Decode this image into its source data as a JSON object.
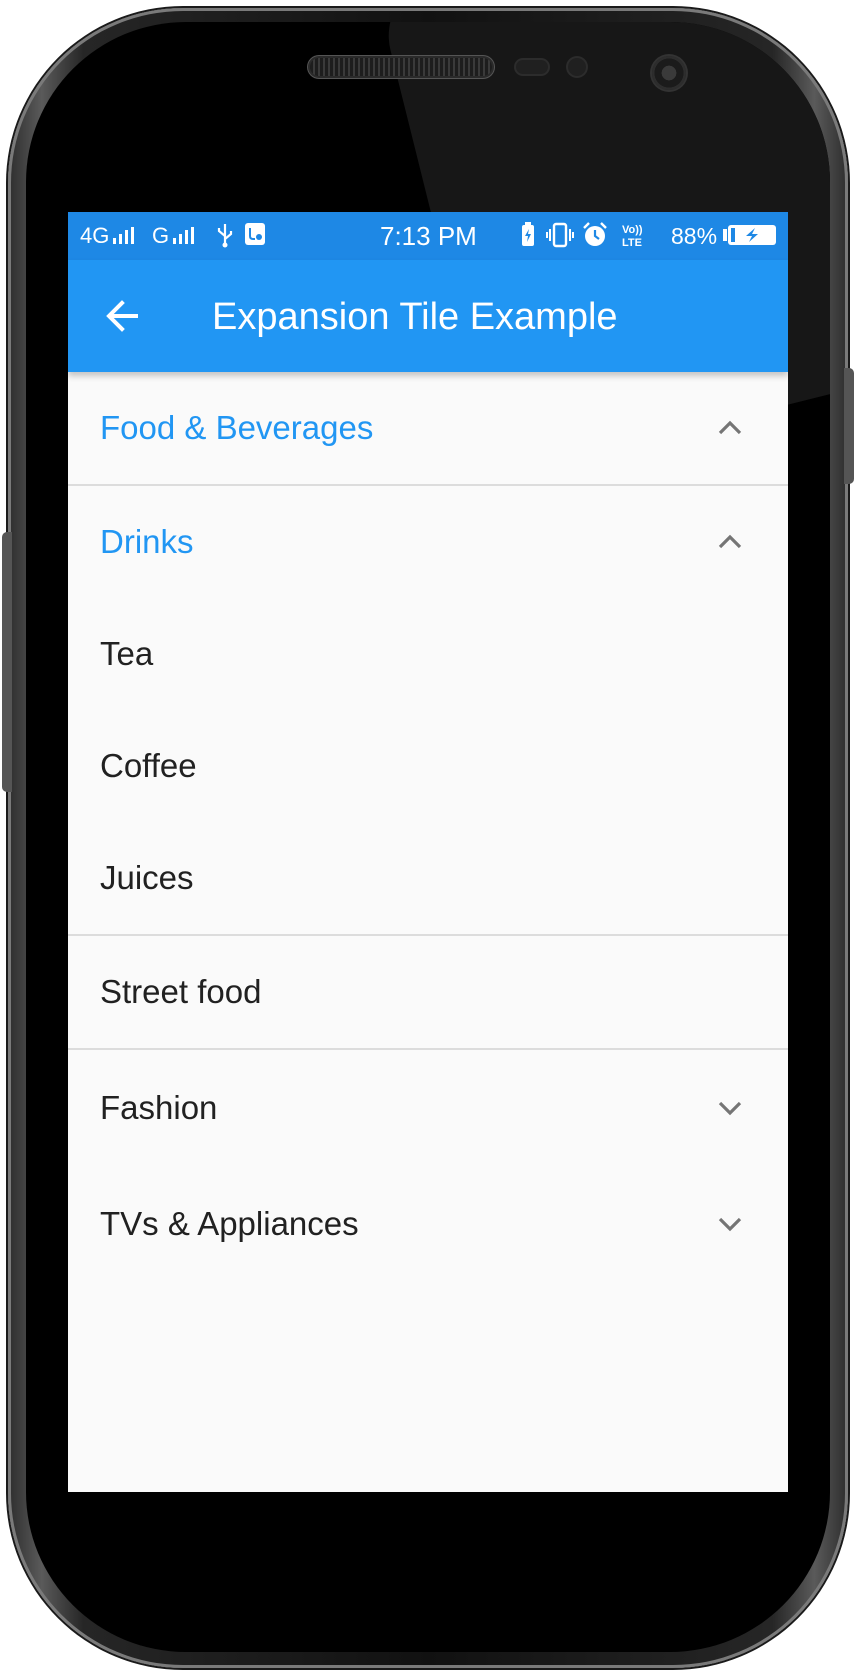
{
  "status_bar": {
    "network_1": "4G",
    "network_2": "G",
    "time": "7:13 PM",
    "volte": "Vo)) LTE",
    "battery_percent": "88%"
  },
  "app_bar": {
    "back_icon": "arrow-back-icon",
    "title": "Expansion Tile Example"
  },
  "list": {
    "food_beverages": {
      "label": "Food & Beverages",
      "expanded": true
    },
    "drinks": {
      "label": "Drinks",
      "expanded": true
    },
    "drinks_children": [
      "Tea",
      "Coffee",
      "Juices"
    ],
    "street_food": {
      "label": "Street food"
    },
    "fashion": {
      "label": "Fashion",
      "expanded": false
    },
    "tvs_appliances": {
      "label": "TVs & Appliances",
      "expanded": false
    }
  },
  "colors": {
    "status_bar": "#1e88e5",
    "app_bar": "#2196f3",
    "accent": "#2196f3",
    "text": "#212121",
    "chevron": "#757575",
    "background": "#fafafa"
  }
}
